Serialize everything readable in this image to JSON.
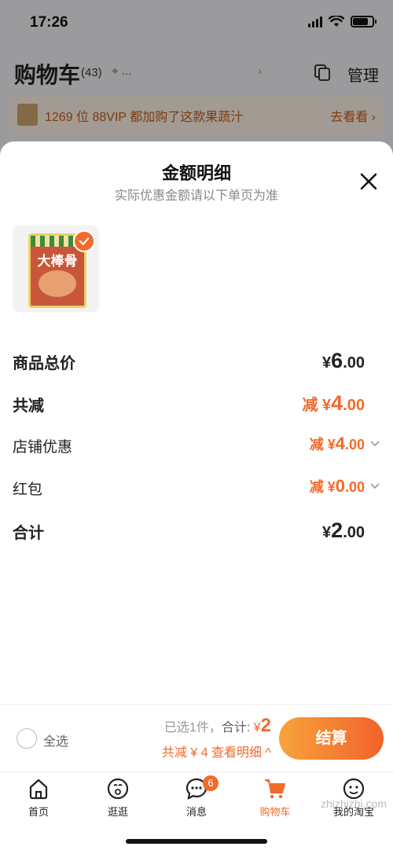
{
  "status_bar": {
    "time": "17:26"
  },
  "cart_header": {
    "title": "购物车",
    "count": "(43)",
    "location": "...",
    "chevron": "›",
    "manage_label": "管理"
  },
  "promo": {
    "text": "1269 位 88VIP 都加购了这款果蔬汁",
    "link": "去看看 ›"
  },
  "sheet": {
    "title": "金额明细",
    "subtitle": "实际优惠金额请以下单页为准",
    "product": {
      "package_name": "大棒骨"
    },
    "rows": [
      {
        "label": "商品总价",
        "prefix": "¥",
        "amount_int": "6",
        "amount_dec": ".00"
      },
      {
        "label": "共减",
        "prefix": "减 ¥",
        "amount_int": "4",
        "amount_dec": ".00"
      },
      {
        "label": "店铺优惠",
        "prefix": "减 ¥",
        "amount_int": "4",
        "amount_dec": ".00"
      },
      {
        "label": "红包",
        "prefix": "减 ¥",
        "amount_int": "0",
        "amount_dec": ".00"
      },
      {
        "label": "合计",
        "prefix": "¥",
        "amount_int": "2",
        "amount_dec": ".00"
      }
    ]
  },
  "checkout": {
    "select_all": "全选",
    "selected_text": "已选1件，",
    "total_label": "合计: ",
    "total_currency": "¥",
    "total_amount": "2",
    "discount_text": "共减 ¥ 4  查看明细 ^",
    "button_label": "结算"
  },
  "tabbar": {
    "tabs": [
      {
        "label": "首页"
      },
      {
        "label": "逛逛"
      },
      {
        "label": "消息",
        "badge": "6"
      },
      {
        "label": "购物车"
      },
      {
        "label": "我的淘宝"
      }
    ]
  },
  "watermark": "zhizhizhi.com",
  "colors": {
    "accent": "#f26a2a",
    "button_start": "#f8a33b",
    "button_end": "#f2622c"
  }
}
